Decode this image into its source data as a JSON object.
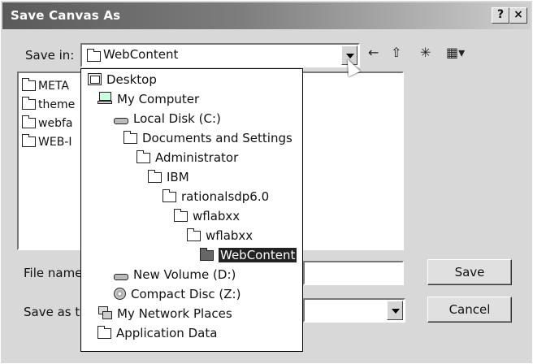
{
  "window": {
    "title": "Save Canvas As",
    "help_label": "?",
    "close_label": "×"
  },
  "save_in": {
    "label": "Save in:",
    "value": "WebContent"
  },
  "toolbar": {
    "back_icon": "←",
    "up_icon": "⇧",
    "new_folder_icon": "✳",
    "view_icon": "▦▾"
  },
  "file_list": [
    {
      "name": "META-INF",
      "visible": "META"
    },
    {
      "name": "theme",
      "visible": "theme"
    },
    {
      "name": "webfa",
      "visible": "webfa"
    },
    {
      "name": "WEB-INF",
      "visible": "WEB-I"
    }
  ],
  "file_name": {
    "label": "File name",
    "value": ""
  },
  "save_as_type": {
    "label": "Save as t",
    "value": ""
  },
  "buttons": {
    "save": "Save",
    "cancel": "Cancel"
  },
  "dropdown_items": [
    {
      "label": "Desktop",
      "icon": "desktop-icon"
    },
    {
      "label": "My Computer",
      "icon": "computer-icon"
    },
    {
      "label": "Local Disk (C:)",
      "icon": "drive-icon"
    },
    {
      "label": "Documents and Settings",
      "icon": "folder-icon"
    },
    {
      "label": "Administrator",
      "icon": "folder-icon"
    },
    {
      "label": "IBM",
      "icon": "folder-icon"
    },
    {
      "label": "rationalsdp6.0",
      "icon": "folder-icon"
    },
    {
      "label": "wflabxx",
      "icon": "folder-icon"
    },
    {
      "label": "wflabxx",
      "icon": "folder-icon"
    },
    {
      "label": "WebContent",
      "icon": "folder-open-icon",
      "selected": true
    },
    {
      "label": "New Volume (D:)",
      "icon": "drive-icon"
    },
    {
      "label": "Compact Disc (Z:)",
      "icon": "cd-icon"
    },
    {
      "label": "My Network Places",
      "icon": "network-icon"
    },
    {
      "label": "Application Data",
      "icon": "folder-icon"
    }
  ]
}
